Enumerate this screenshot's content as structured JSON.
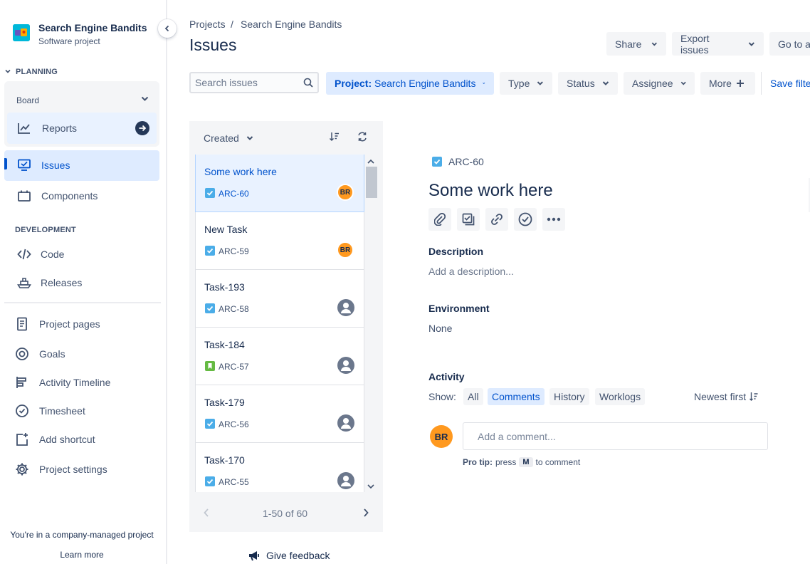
{
  "sidebar": {
    "project_name": "Search Engine Bandits",
    "project_type": "Software project",
    "planning_heading": "PLANNING",
    "board_label": "Board",
    "reports_label": "Reports",
    "issues_label": "Issues",
    "components_label": "Components",
    "development_heading": "DEVELOPMENT",
    "code_label": "Code",
    "releases_label": "Releases",
    "project_pages_label": "Project pages",
    "goals_label": "Goals",
    "activity_timeline_label": "Activity Timeline",
    "timesheet_label": "Timesheet",
    "add_shortcut_label": "Add shortcut",
    "project_settings_label": "Project settings",
    "footer_text": "You're in a company-managed project",
    "learn_more": "Learn more"
  },
  "header": {
    "breadcrumb_projects": "Projects",
    "breadcrumb_sep": "/",
    "breadcrumb_project": "Search Engine Bandits",
    "title": "Issues",
    "share_label": "Share",
    "export_label": "Export issues",
    "goto_label": "Go to a"
  },
  "filters": {
    "search_placeholder": "Search issues",
    "project_prefix": "Project:",
    "project_value": "Search Engine Bandits",
    "type_label": "Type",
    "status_label": "Status",
    "assignee_label": "Assignee",
    "more_label": "More",
    "save_filter_label": "Save filter"
  },
  "list": {
    "sort_label": "Created",
    "pager_text": "1-50 of 60",
    "items": [
      {
        "title": "Some work here",
        "key": "ARC-60",
        "type": "task",
        "assignee": "BR",
        "selected": true
      },
      {
        "title": "New Task",
        "key": "ARC-59",
        "type": "task",
        "assignee": "BR",
        "selected": false
      },
      {
        "title": "Task-193",
        "key": "ARC-58",
        "type": "task",
        "assignee": "",
        "selected": false
      },
      {
        "title": "Task-184",
        "key": "ARC-57",
        "type": "story",
        "assignee": "",
        "selected": false
      },
      {
        "title": "Task-179",
        "key": "ARC-56",
        "type": "task",
        "assignee": "",
        "selected": false
      },
      {
        "title": "Task-170",
        "key": "ARC-55",
        "type": "task",
        "assignee": "",
        "selected": false
      }
    ],
    "feedback_label": "Give feedback"
  },
  "detail": {
    "key": "ARC-60",
    "title": "Some work here",
    "description_label": "Description",
    "description_placeholder": "Add a description...",
    "environment_label": "Environment",
    "environment_value": "None",
    "activity_label": "Activity",
    "show_label": "Show:",
    "tabs": [
      "All",
      "Comments",
      "History",
      "Worklogs"
    ],
    "active_tab": "Comments",
    "sort_label": "Newest first",
    "user_initials": "BR",
    "comment_placeholder": "Add a comment...",
    "protip_prefix": "Pro tip:",
    "protip_press": "press",
    "protip_key": "M",
    "protip_suffix": "to comment"
  },
  "colors": {
    "brand": "#0052cc",
    "selected_bg": "#e9f2ff",
    "avatar": "#ff991f",
    "task_icon": "#4bade8",
    "story_icon": "#65ba43"
  }
}
